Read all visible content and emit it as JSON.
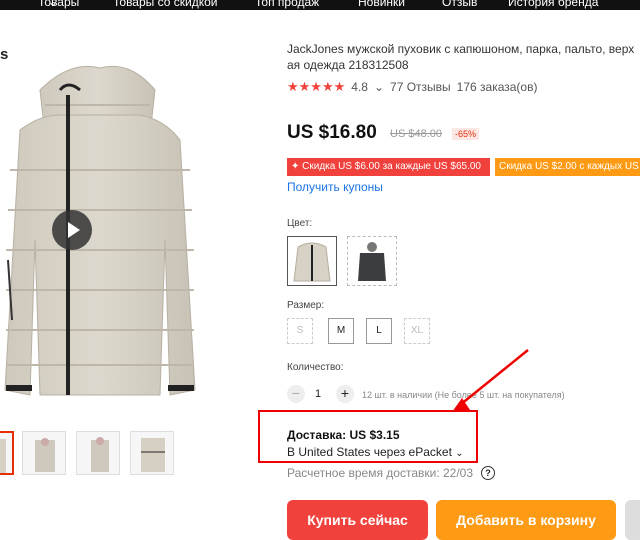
{
  "nav": {
    "items": [
      "Товары",
      "Товары со скидкой",
      "Топ продаж",
      "Новинки",
      "Отзыв",
      "История бренда"
    ]
  },
  "gallery": {
    "brand_fragment": "s",
    "thumbnails_count": 4
  },
  "product": {
    "title_line1": "JackJones мужской пуховик с капюшоном, парка, пальто, верх",
    "title_line2": "ая одежда 218312508",
    "stars": "★★★★★",
    "rating": "4.8",
    "reviews": "77 Отзывы",
    "orders": "176 заказа(ов)",
    "price": "US $16.80",
    "old_price": "US $48.00",
    "discount": "-65%"
  },
  "coupons": {
    "badge1": "✦ Скидка US $6.00 за каждые US $65.00",
    "badge2": "Скидка US $2.00 с каждых US",
    "link": "Получить купоны"
  },
  "options": {
    "color_label": "Цвет:",
    "size_label": "Размер:",
    "sizes": [
      "S",
      "M",
      "L",
      "XL"
    ],
    "quantity_label": "Количество:",
    "quantity": "1",
    "stock": "12 шт. в наличии (Не более 5 шт. на покупателя)"
  },
  "shipping": {
    "price": "Доставка: US $3.15",
    "method": "В United States через ePacket",
    "eta": "Расчетное время доставки: 22/03"
  },
  "actions": {
    "buy": "Купить сейчас",
    "cart": "Добавить в корзину"
  },
  "colors": {
    "accent_red": "#f1413c",
    "accent_orange": "#ff9a14",
    "link_blue": "#1a73e8",
    "highlight_red": "#e00000"
  }
}
